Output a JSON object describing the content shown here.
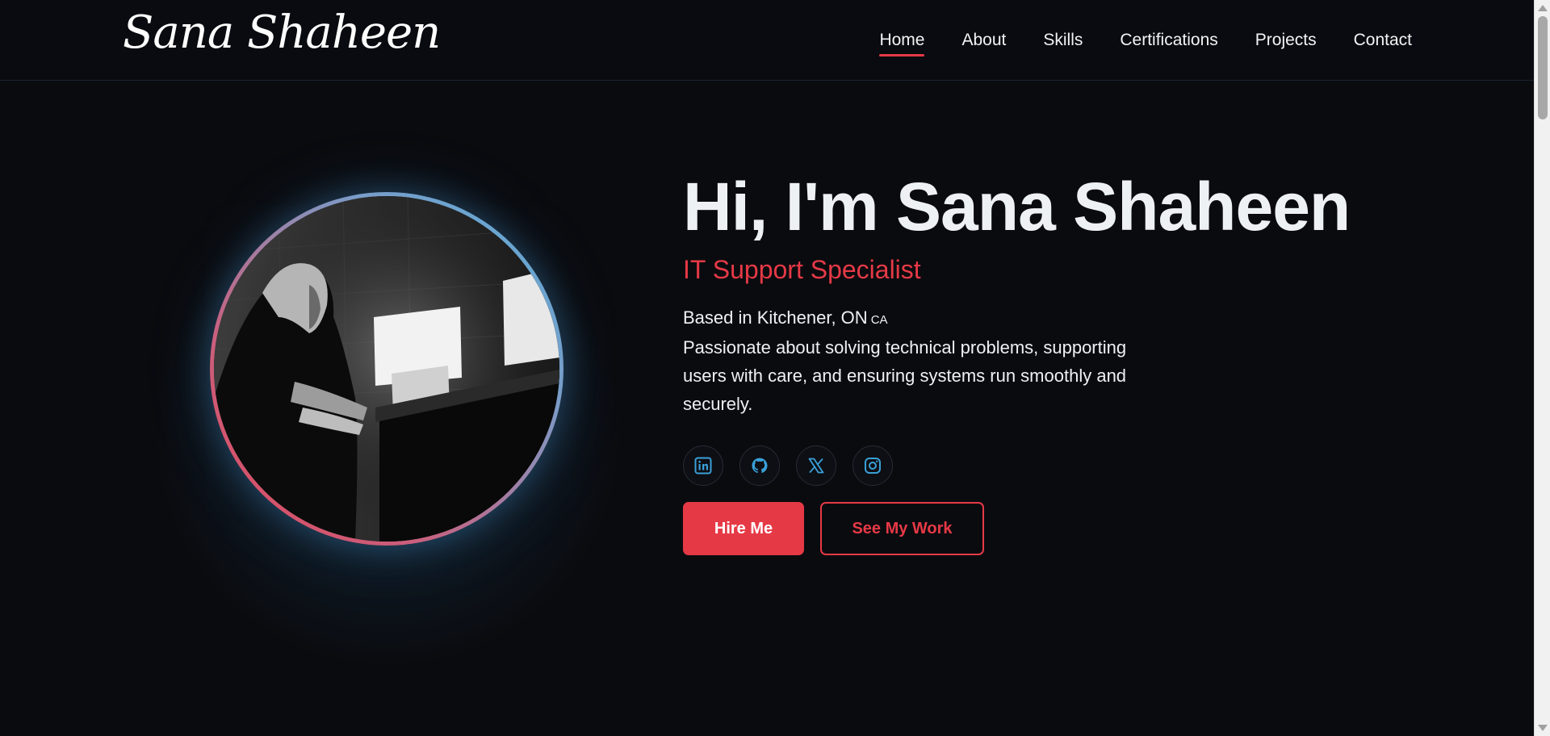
{
  "header": {
    "logo": "Sana Shaheen",
    "nav": [
      {
        "label": "Home",
        "active": true
      },
      {
        "label": "About"
      },
      {
        "label": "Skills"
      },
      {
        "label": "Certifications"
      },
      {
        "label": "Projects"
      },
      {
        "label": "Contact"
      }
    ]
  },
  "hero": {
    "title": "Hi, I'm Sana Shaheen",
    "role": "IT Support Specialist",
    "location": "Based in Kitchener, ON",
    "country_code": "CA",
    "description": "Passionate about solving technical problems, supporting users with care, and ensuring systems run smoothly and securely.",
    "socials": [
      {
        "name": "linkedin-icon"
      },
      {
        "name": "github-icon"
      },
      {
        "name": "x-icon"
      },
      {
        "name": "instagram-icon"
      }
    ],
    "buttons": {
      "primary": "Hire Me",
      "secondary": "See My Work"
    }
  },
  "colors": {
    "background": "#0a0b0f",
    "accent": "#e63946",
    "icon": "#3aa0d8",
    "ring_blue": "#5aaed8",
    "ring_red": "#e0475a"
  }
}
